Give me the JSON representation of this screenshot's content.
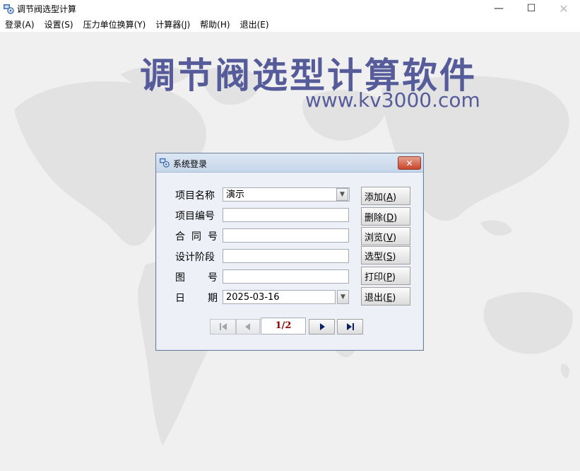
{
  "window": {
    "title": "调节阀选型计算",
    "minimize": "—",
    "maximize": "☐",
    "close": "✕"
  },
  "menu": [
    "登录(A)",
    "设置(S)",
    "压力单位换算(Y)",
    "计算器(J)",
    "帮助(H)",
    "退出(E)"
  ],
  "banner": {
    "title": "调节阀选型计算软件",
    "url": "www.kv3000.com"
  },
  "dialog": {
    "title": "系统登录",
    "close": "✕",
    "fields": {
      "project_name": {
        "label": "项目名称",
        "value": "演示"
      },
      "project_no": {
        "label": "项目编号",
        "value": ""
      },
      "contract_no": {
        "label": "合同号",
        "value": ""
      },
      "design_stage": {
        "label": "设计阶段",
        "value": ""
      },
      "drawing_no": {
        "label": "图号",
        "value": ""
      },
      "date": {
        "label": "日期",
        "value": "2025-03-16"
      }
    },
    "buttons": {
      "add": {
        "text": "添加(",
        "key": "A",
        "end": ")"
      },
      "delete": {
        "text": "删除(",
        "key": "D",
        "end": ")"
      },
      "browse": {
        "text": "浏览(",
        "key": "V",
        "end": ")"
      },
      "select": {
        "text": "选型(",
        "key": "S",
        "end": ")"
      },
      "print": {
        "text": "打印(",
        "key": "P",
        "end": ")"
      },
      "exit": {
        "text": "退出(",
        "key": "E",
        "end": ")"
      }
    },
    "pager": "1/2"
  },
  "colors": {
    "banner": "#565c9a",
    "pager_text": "#8b0000",
    "close_button": "#c8452c"
  }
}
